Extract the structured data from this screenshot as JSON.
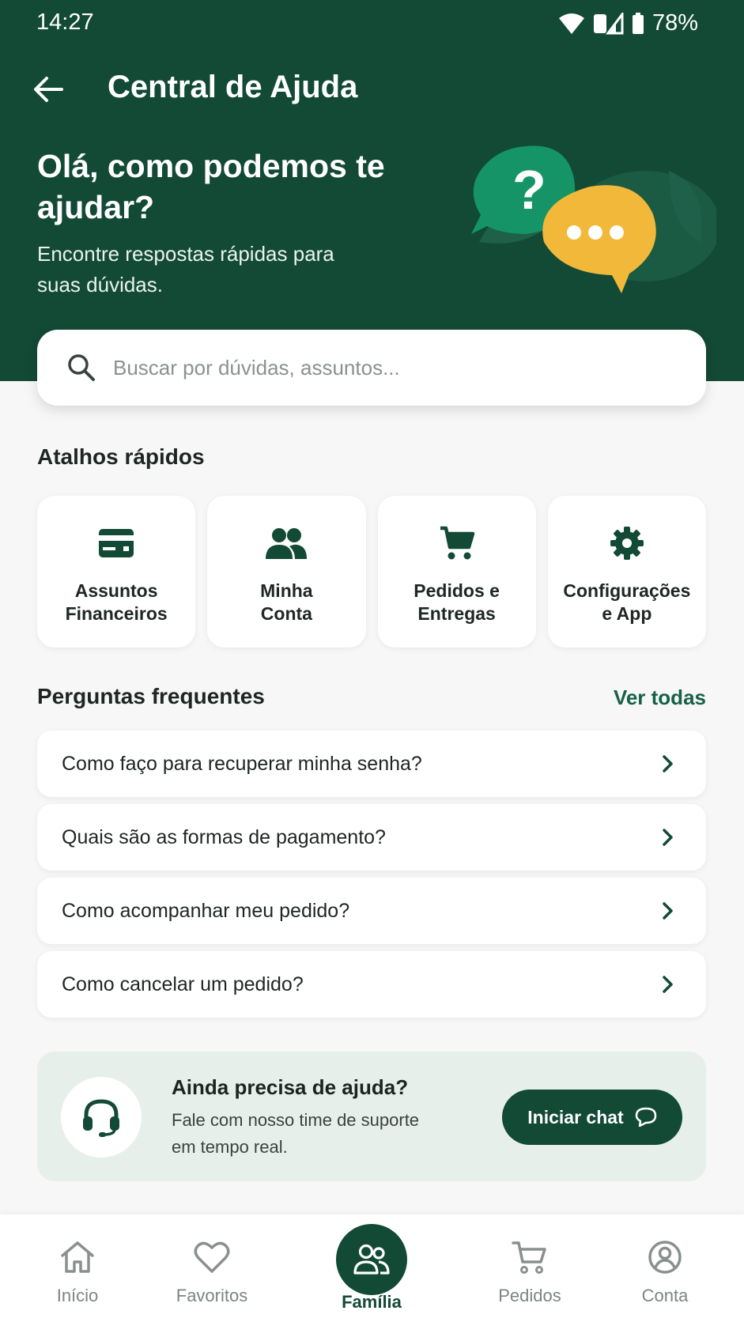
{
  "status": {
    "time": "14:27",
    "battery": "78%"
  },
  "topbar": {
    "title": "Central de Ajuda"
  },
  "hero": {
    "title": "Olá, como podemos te ajudar?",
    "subtitle": "Encontre respostas rápidas para suas dúvidas."
  },
  "search": {
    "placeholder": "Buscar por dúvidas, assuntos...",
    "value": ""
  },
  "shortcuts": {
    "title": "Atalhos rápidos",
    "items": [
      {
        "label": "Assuntos\nFinanceiros",
        "icon": "credit-card-icon"
      },
      {
        "label": "Minha\nConta",
        "icon": "people-icon"
      },
      {
        "label": "Pedidos e\nEntregas",
        "icon": "shopping-cart-icon"
      },
      {
        "label": "Configurações\ne App",
        "icon": "gear-icon"
      }
    ]
  },
  "faq": {
    "title": "Perguntas frequentes",
    "see_all": "Ver todas",
    "items": [
      "Como faço para recuperar minha senha?",
      "Quais são as formas de pagamento?",
      "Como acompanhar meu pedido?",
      "Como cancelar um pedido?"
    ]
  },
  "help": {
    "title": "Ainda precisa de ajuda?",
    "subtitle": "Fale com nosso time de suporte em tempo real.",
    "button": "Iniciar chat"
  },
  "nav": {
    "items": [
      "Início",
      "Favoritos",
      "Família",
      "Pedidos",
      "Conta"
    ],
    "active": "Família"
  },
  "colors": {
    "primary": "#124a36",
    "accent_green": "#176148",
    "bubble_green": "#159467",
    "bubble_yellow": "#f2b83a"
  }
}
